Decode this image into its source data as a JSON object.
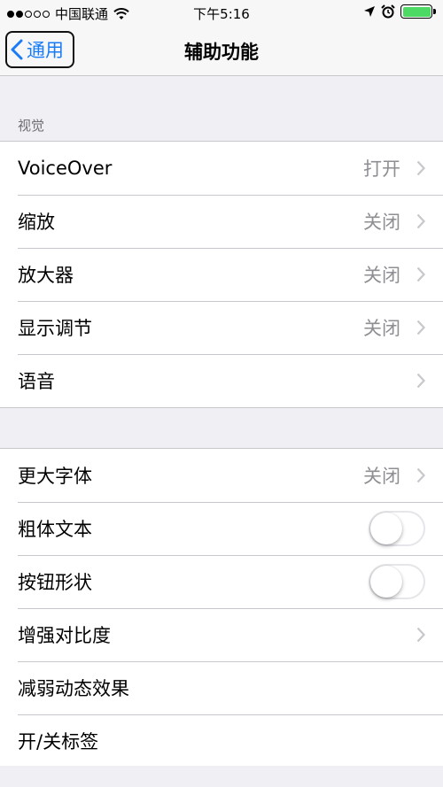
{
  "status_bar": {
    "carrier": "中国联通",
    "time": "下午5:16"
  },
  "nav": {
    "back_label": "通用",
    "title": "辅助功能"
  },
  "section_vision": {
    "header": "视觉",
    "items": [
      {
        "label": "VoiceOver",
        "value": "打开"
      },
      {
        "label": "缩放",
        "value": "关闭"
      },
      {
        "label": "放大器",
        "value": "关闭"
      },
      {
        "label": "显示调节",
        "value": "关闭"
      },
      {
        "label": "语音",
        "value": ""
      }
    ]
  },
  "section_text": {
    "items": [
      {
        "label": "更大字体",
        "value": "关闭"
      },
      {
        "label": "粗体文本",
        "toggle": false
      },
      {
        "label": "按钮形状",
        "toggle": false
      },
      {
        "label": "增强对比度",
        "value": ""
      },
      {
        "label": "减弱动态效果",
        "value": ""
      },
      {
        "label": "开/关标签",
        "value": ""
      }
    ]
  },
  "colors": {
    "accent": "#1a7cf5",
    "battery": "#4cd964",
    "background": "#efeff4"
  }
}
